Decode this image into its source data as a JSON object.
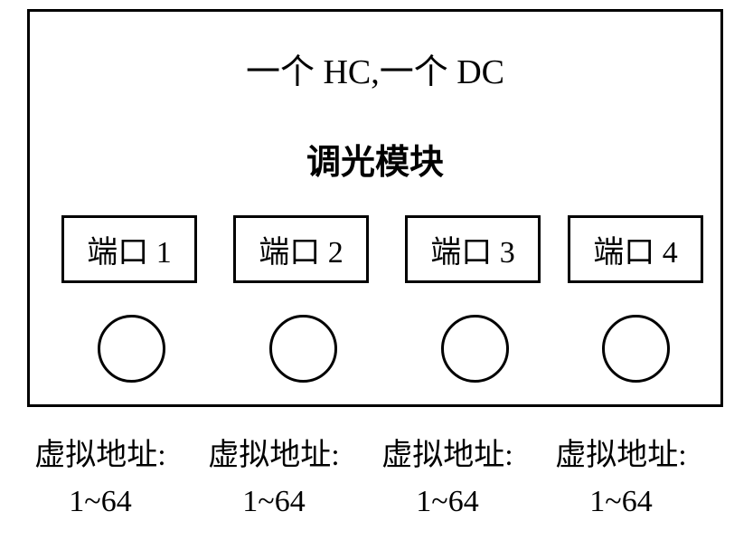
{
  "title": "一个 HC,一个 DC",
  "subtitle": "调光模块",
  "ports": [
    {
      "label": "端口 1"
    },
    {
      "label": "端口 2"
    },
    {
      "label": "端口 3"
    },
    {
      "label": "端口 4"
    }
  ],
  "addresses": [
    {
      "label": "虚拟地址:",
      "range": "1~64"
    },
    {
      "label": "虚拟地址:",
      "range": "1~64"
    },
    {
      "label": "虚拟地址:",
      "range": "1~64"
    },
    {
      "label": "虚拟地址:",
      "range": "1~64"
    }
  ]
}
